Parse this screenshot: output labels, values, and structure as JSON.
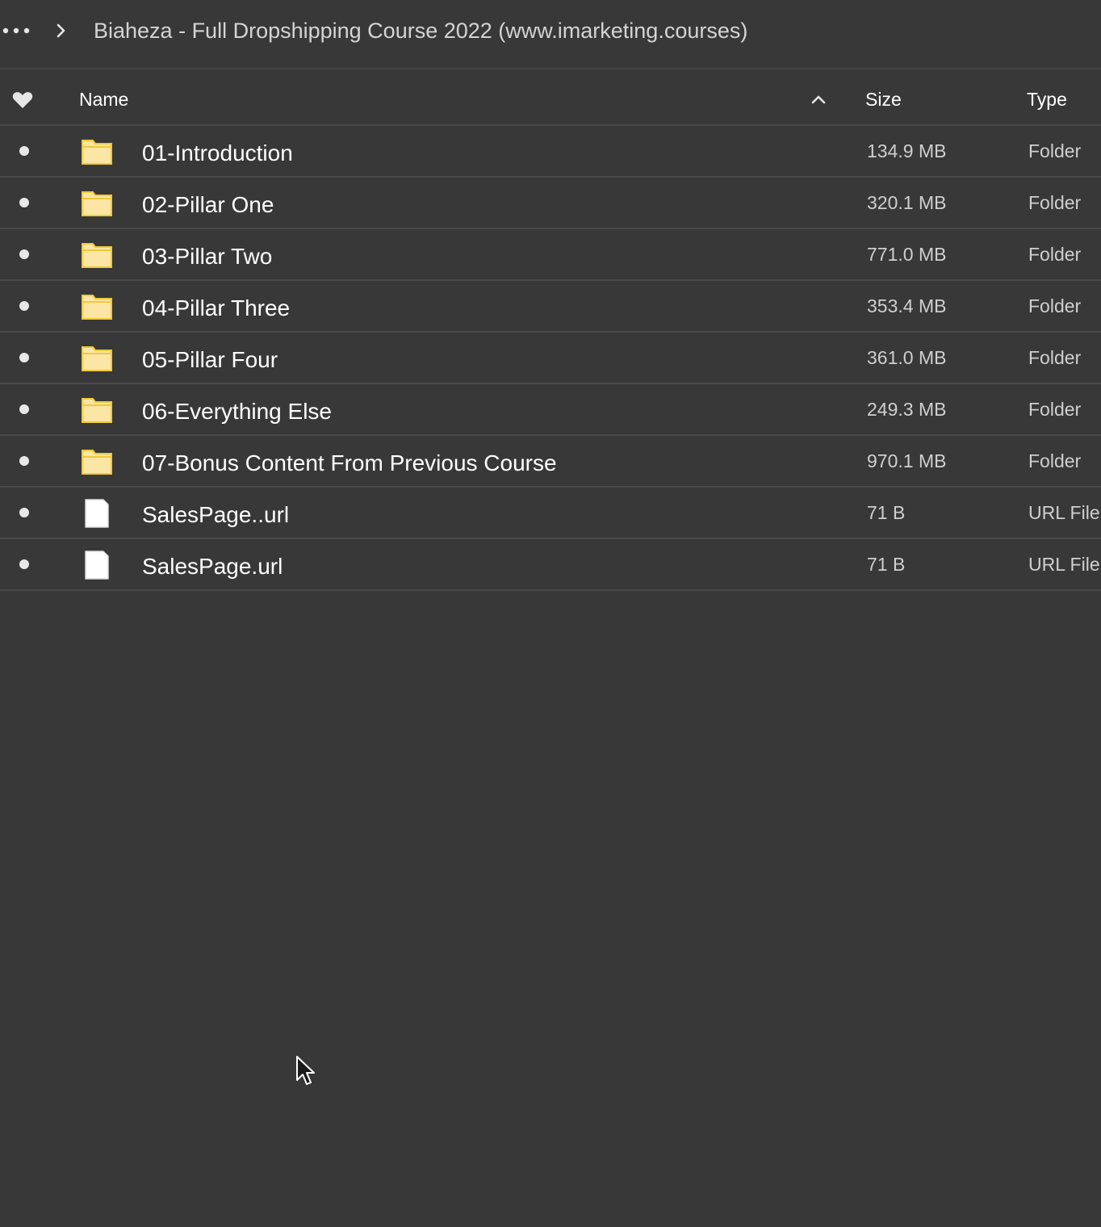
{
  "breadcrumb": {
    "more_icon": "more-horizontal-icon",
    "separator_icon": "chevron-right-icon",
    "title": "Biaheza - Full Dropshipping Course 2022 (www.imarketing.courses)"
  },
  "table": {
    "headers": {
      "favorite_icon": "heart-icon",
      "name": "Name",
      "sort_icon": "chevron-up-icon",
      "sort_direction": "ascending",
      "size": "Size",
      "type": "Type"
    },
    "rows": [
      {
        "icon": "folder-icon",
        "name": "01-Introduction",
        "size": "134.9 MB",
        "type": "Folder"
      },
      {
        "icon": "folder-icon",
        "name": "02-Pillar One",
        "size": "320.1 MB",
        "type": "Folder"
      },
      {
        "icon": "folder-icon",
        "name": "03-Pillar Two",
        "size": "771.0 MB",
        "type": "Folder"
      },
      {
        "icon": "folder-icon",
        "name": "04-Pillar Three",
        "size": "353.4 MB",
        "type": "Folder"
      },
      {
        "icon": "folder-icon",
        "name": "05-Pillar Four",
        "size": "361.0 MB",
        "type": "Folder"
      },
      {
        "icon": "folder-icon",
        "name": "06-Everything Else",
        "size": "249.3 MB",
        "type": "Folder"
      },
      {
        "icon": "folder-icon",
        "name": "07-Bonus Content From Previous Course",
        "size": "970.1 MB",
        "type": "Folder"
      },
      {
        "icon": "file-icon",
        "name": "SalesPage..url",
        "size": "71 B",
        "type": "URL File"
      },
      {
        "icon": "file-icon",
        "name": "SalesPage.url",
        "size": "71 B",
        "type": "URL File"
      }
    ]
  },
  "colors": {
    "background": "#383838",
    "divider": "#4a4a4a",
    "folder_fill": "#fbe6a6",
    "folder_stroke": "#f0c93a",
    "text": "#ffffff",
    "muted_text": "#cfcfcf"
  }
}
